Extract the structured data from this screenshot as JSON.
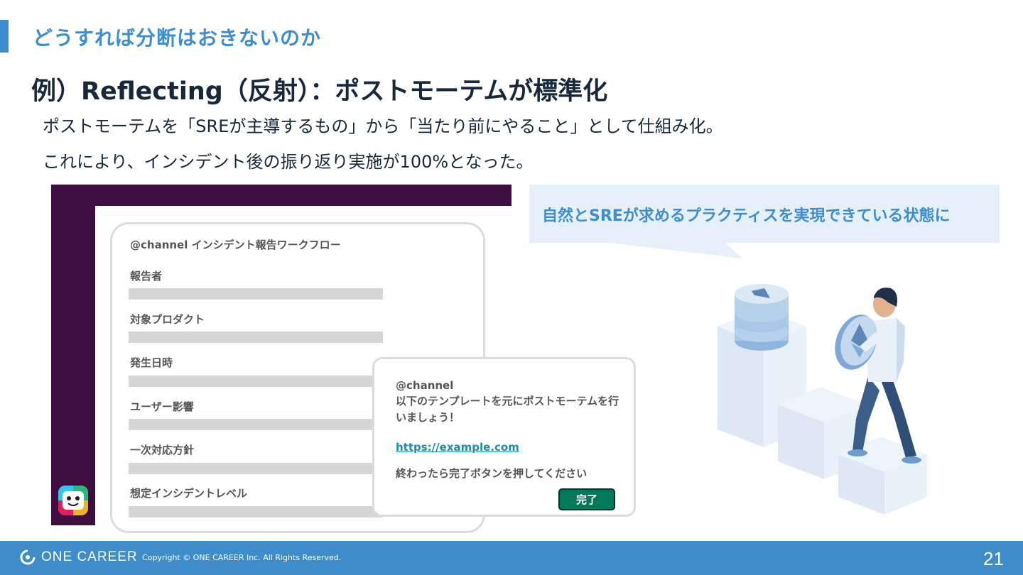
{
  "header": {
    "section_title": "どうすれば分断はおきないのか",
    "heading": "例）Reflecting（反射）：ポストモーテムが標準化"
  },
  "body": {
    "line1": "ポストモーテムを「SREが主導するもの」から「当たり前にやること」として仕組み化。",
    "line2": "これにより、インシデント後の振り返り実施が100%となった。"
  },
  "workflow": {
    "title": "@channel インシデント報告ワークフロー",
    "fields": [
      "報告者",
      "対象プロダクト",
      "発生日時",
      "ユーザー影響",
      "一次対応方針",
      "想定インシデントレベル"
    ]
  },
  "message": {
    "mention": "@channel",
    "body": "以下のテンプレートを元にポストモーテムを行いましょう！",
    "link": "https://example.com",
    "note": "終わったら完了ボタンを押してください",
    "button_label": "完了"
  },
  "callout": {
    "text": "自然とSREが求めるプラクティスを実現できている状態に"
  },
  "footer": {
    "brand": "ONE CAREER",
    "copyright": "Copyright © ONE CAREER Inc. All Rights Reserved.",
    "page_number": "21"
  },
  "colors": {
    "accent": "#3d8dcf",
    "slack_aubergine": "#3f0e40",
    "button_green": "#007a5a",
    "footer_blue": "#3f8ccb"
  }
}
